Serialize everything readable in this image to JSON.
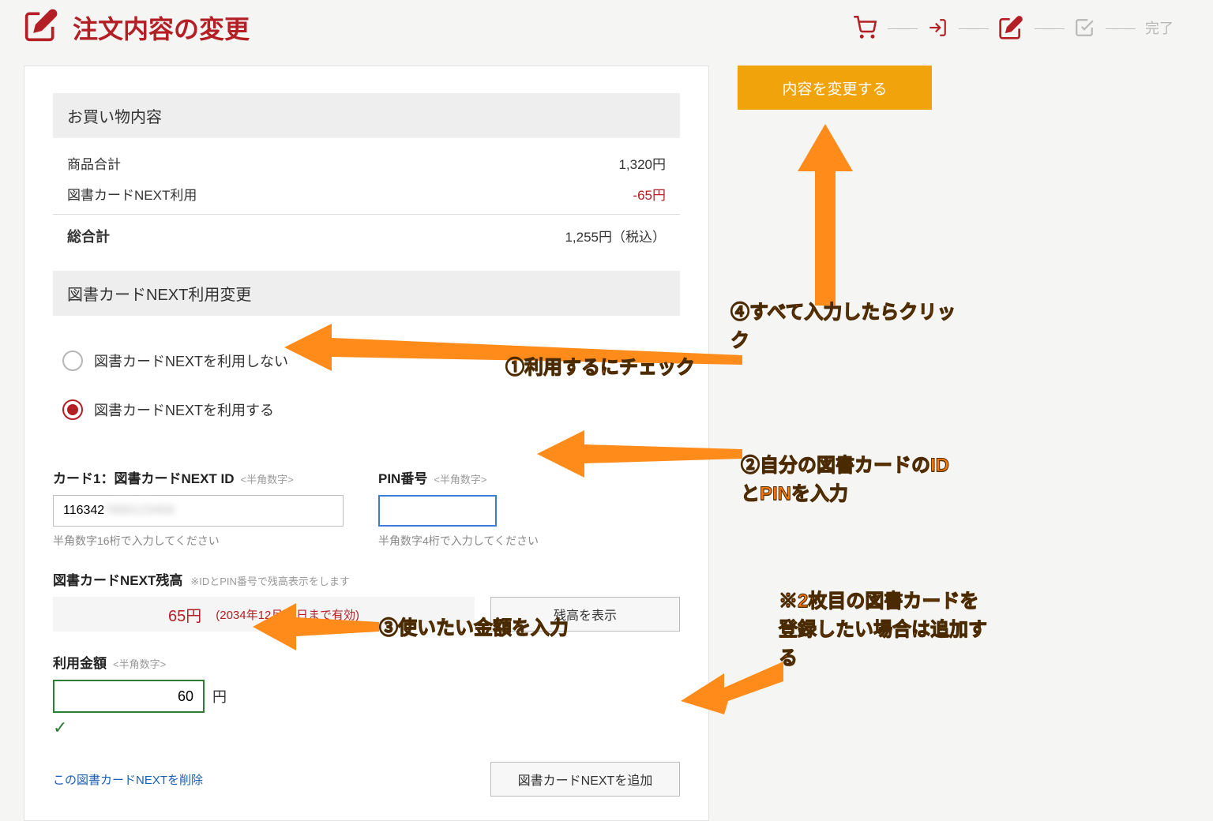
{
  "header": {
    "title": "注文内容の変更",
    "progress": {
      "final_label": "完了"
    }
  },
  "summary": {
    "head": "お買い物内容",
    "rows": {
      "subtotal_label": "商品合計",
      "subtotal_value": "1,320円",
      "discount_label": "図書カードNEXT利用",
      "discount_value": "-65円",
      "total_label": "総合計",
      "total_value": "1,255円（税込）"
    }
  },
  "next": {
    "head": "図書カードNEXT利用変更",
    "option_off": "図書カードNEXTを利用しない",
    "option_on": "図書カードNEXTを利用する"
  },
  "card": {
    "id_label": "カード1：図書カードNEXT ID",
    "half_num_hint": "<半角数字>",
    "id_value": "116342",
    "id_sub": "半角数字16桁で入力してください",
    "pin_label": "PIN番号",
    "pin_value": "",
    "pin_sub": "半角数字4桁で入力してください"
  },
  "balance": {
    "label": "図書カードNEXT残高",
    "hint": "※IDとPIN番号で残高表示をします",
    "amount": "65円",
    "expires": "(2034年12月31日まで有効)",
    "show_btn": "残高を表示"
  },
  "use": {
    "label": "利用金額",
    "value": "60",
    "unit": "円"
  },
  "actions": {
    "delete_link": "この図書カードNEXTを削除",
    "add_btn": "図書カードNEXTを追加"
  },
  "sidebar": {
    "submit": "内容を変更する"
  },
  "annotations": {
    "a1": "①利用するにチェック",
    "a2_line1": "②自分の図書カードのID",
    "a2_line2": "とPINを入力",
    "a3": "③使いたい金額を入力",
    "a4_line1": "④すべて入力したらクリッ",
    "a4_line2": "ク",
    "a5_line1": "※2枚目の図書カードを",
    "a5_line2": "登録したい場合は追加す",
    "a5_line3": "る"
  }
}
